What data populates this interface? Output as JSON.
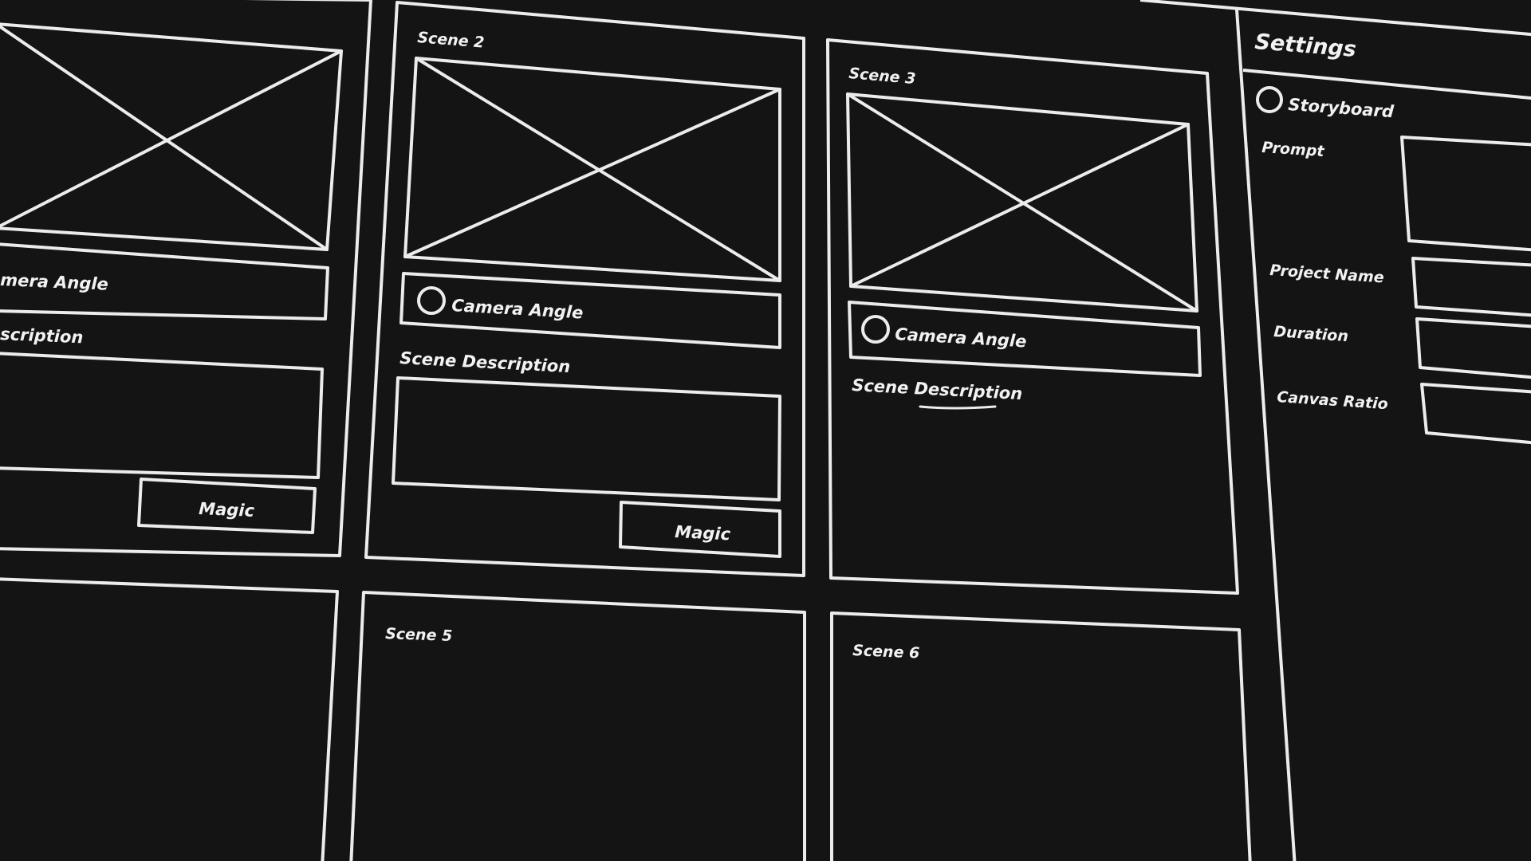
{
  "scenes": {
    "scene_1": {
      "camera_angle_partial": "mera Angle",
      "description_partial": "scription",
      "magic_button": "Magic"
    },
    "scene_2": {
      "title": "Scene 2",
      "camera_angle": "Camera Angle",
      "description_label": "Scene Description",
      "magic_button": "Magic"
    },
    "scene_3": {
      "title": "Scene 3",
      "camera_angle": "Camera Angle",
      "description_label": "Scene Description"
    },
    "scene_5": {
      "title": "Scene 5"
    },
    "scene_6": {
      "title": "Scene 6"
    }
  },
  "settings": {
    "title": "Settings",
    "storyboard_option": "Storyboard",
    "prompt_label": "Prompt",
    "project_name_label": "Project Name",
    "duration_label": "Duration",
    "canvas_ratio_label": "Canvas Ratio"
  },
  "icons": {
    "placeholder_image": "image-placeholder-icon",
    "radio": "radio-icon"
  },
  "colors": {
    "background": "#141414",
    "stroke": "#ececec",
    "text": "#f2f2f2"
  }
}
